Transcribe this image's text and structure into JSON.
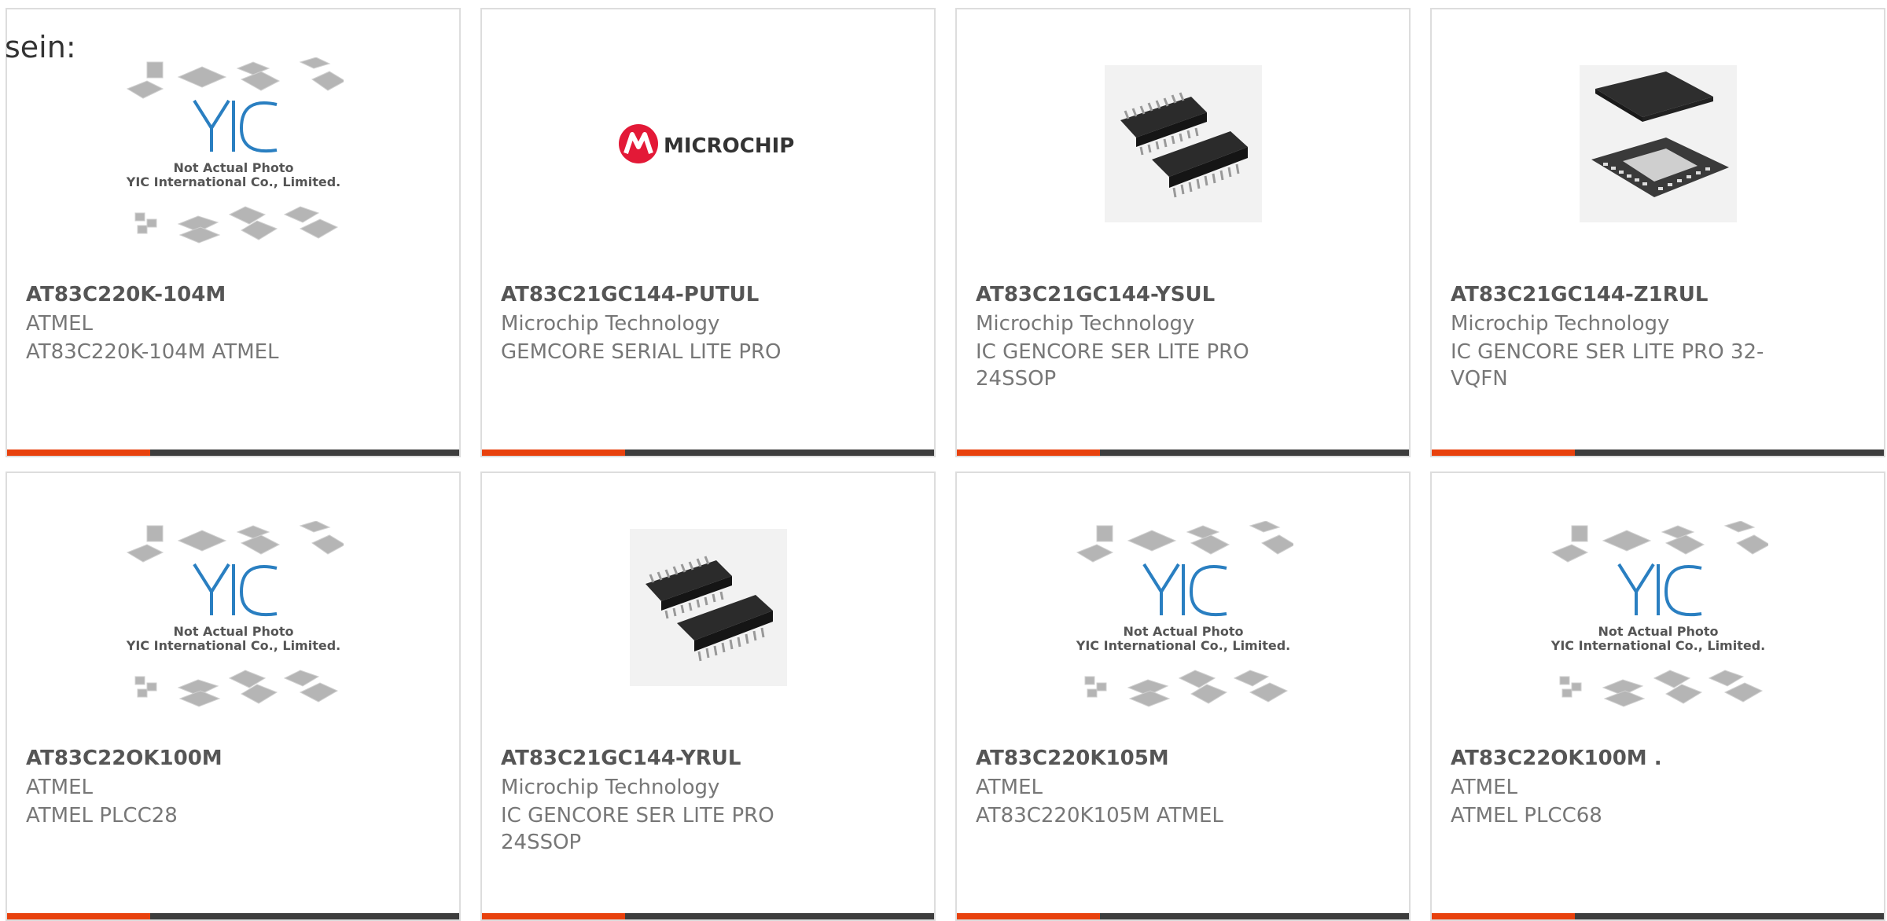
{
  "intro_text": "sein:",
  "colors": {
    "accent": "#e8410d",
    "bar": "#3d3d3d",
    "border": "#dddddd",
    "microchip_red": "#e31937",
    "yic_blue": "#2a7fc1"
  },
  "placeholder_image": {
    "logo_text": "YIC",
    "line1": "Not Actual Photo",
    "line2": "YIC International Co., Limited."
  },
  "microchip_logo_text": "MICROCHIP",
  "products": [
    {
      "part": "AT83C220K-104M",
      "manufacturer": "ATMEL",
      "desc_lines": [
        "AT83C220K-104M ATMEL"
      ],
      "image": "yic-placeholder"
    },
    {
      "part": "AT83C21GC144-PUTUL",
      "manufacturer": "Microchip Technology",
      "desc_lines": [
        "GEMCORE SERIAL LITE PRO"
      ],
      "image": "microchip-logo"
    },
    {
      "part": "AT83C21GC144-YSUL",
      "manufacturer": "Microchip Technology",
      "desc_lines": [
        "IC GENCORE SER LITE PRO",
        "24SSOP"
      ],
      "image": "ssop-chip"
    },
    {
      "part": "AT83C21GC144-Z1RUL",
      "manufacturer": "Microchip Technology",
      "desc_lines": [
        "IC GENCORE SER LITE PRO 32-",
        "VQFN"
      ],
      "image": "qfn-chip"
    },
    {
      "part": "AT83C22OK100M",
      "manufacturer": "ATMEL",
      "desc_lines": [
        "ATMEL PLCC28"
      ],
      "image": "yic-placeholder"
    },
    {
      "part": "AT83C21GC144-YRUL",
      "manufacturer": "Microchip Technology",
      "desc_lines": [
        "IC GENCORE SER LITE PRO",
        "24SSOP"
      ],
      "image": "ssop-chip"
    },
    {
      "part": "AT83C220K105M",
      "manufacturer": "ATMEL",
      "desc_lines": [
        "AT83C220K105M ATMEL"
      ],
      "image": "yic-placeholder"
    },
    {
      "part": "AT83C22OK100M .",
      "manufacturer": "ATMEL",
      "desc_lines": [
        "ATMEL PLCC68"
      ],
      "image": "yic-placeholder"
    }
  ]
}
